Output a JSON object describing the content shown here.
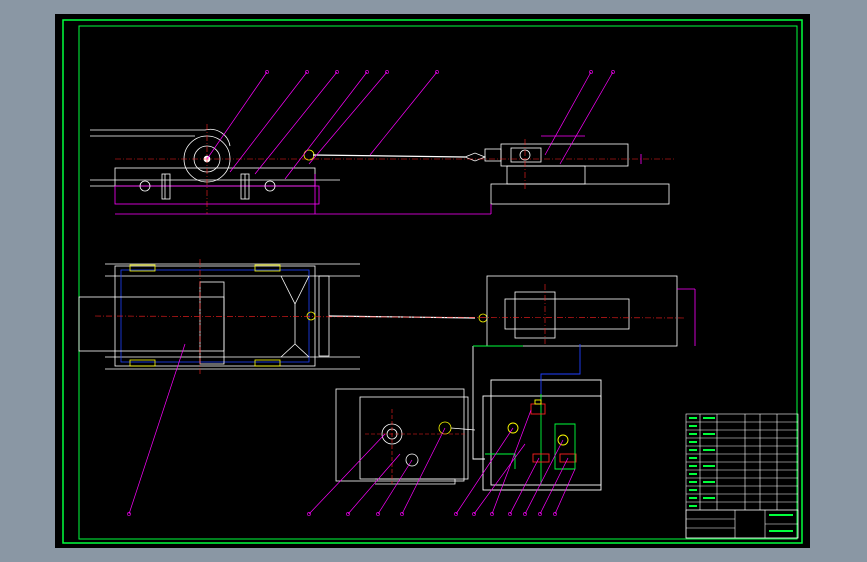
{
  "window": {
    "background_color": "#8a97a4",
    "sheet_background": "#000000"
  },
  "drawing": {
    "colors": {
      "border": "#00ff3c",
      "outline": "#ffffff",
      "leader": "#ff00ff",
      "centerline": "#ff2020",
      "hidden": "#2040ff",
      "accent": "#ffff00"
    },
    "views": [
      "side-elevation-view",
      "plan-view",
      "pump-station-view",
      "hydraulic-schematic"
    ],
    "balloon_count": 20,
    "title_block": {
      "parts_list_rows": 16
    }
  }
}
